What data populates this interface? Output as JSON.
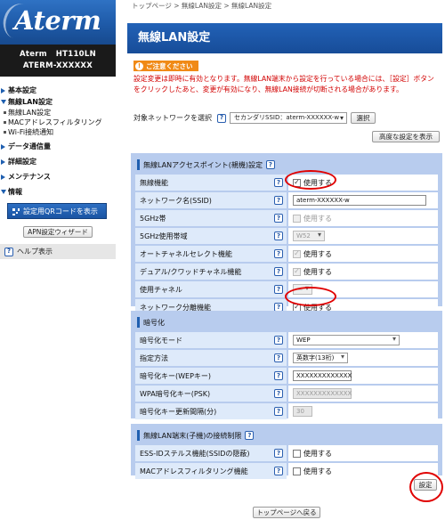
{
  "brand": {
    "logo": "Aterm",
    "model": "Aterm   HT110LN",
    "serial": "ATERM-XXXXXX"
  },
  "sidebar": {
    "items": [
      {
        "label": "基本設定",
        "expanded": false
      },
      {
        "label": "無線LAN設定",
        "expanded": true
      },
      {
        "label": "データ通信量",
        "expanded": false
      },
      {
        "label": "詳細設定",
        "expanded": false
      },
      {
        "label": "メンテナンス",
        "expanded": false
      },
      {
        "label": "情報",
        "expanded": true
      }
    ],
    "wifi_sub": [
      "無線LAN設定",
      "MACアドレスフィルタリング",
      "Wi-Fi接続通知"
    ],
    "qr_button": "設定用QRコードを表示",
    "apn_button": "APN設定ウィザード",
    "help": "ヘルプ表示"
  },
  "breadcrumb": "トップページ > 無線LAN設定 > 無線LAN設定",
  "page_title": "無線LAN設定",
  "notice": {
    "heading": "ご注意ください",
    "text": "設定変更は即時に有効となります。無線LAN端末から設定を行っている場合には、［設定］ボタンをクリックしたあと、変更が有効になり、無線LAN接続が切断される場合があります。"
  },
  "target": {
    "label": "対象ネットワークを選択",
    "value": "セカンダリSSID：aterm-XXXXXX-w",
    "button": "選択"
  },
  "advanced_button": "高度な設定を表示",
  "sections": {
    "ap": {
      "title": "無線LANアクセスポイント(親機)設定",
      "rows": {
        "enable": {
          "label": "無線機能",
          "value": "使用する",
          "checked": true
        },
        "ssid": {
          "label": "ネットワーク名(SSID)",
          "value": "aterm-XXXXXX-w"
        },
        "band5": {
          "label": "5GHz帯",
          "value": "使用する",
          "checked": false
        },
        "band5_width": {
          "label": "5GHz使用帯域",
          "value": "W52"
        },
        "auto_channel": {
          "label": "オートチャネルセレクト機能",
          "value": "使用する",
          "checked": true
        },
        "dual_channel": {
          "label": "デュアル/クワッドチャネル機能",
          "value": "使用する",
          "checked": true
        },
        "channel": {
          "label": "使用チャネル",
          "value": "—"
        },
        "separator": {
          "label": "ネットワーク分離機能",
          "value": "使用する",
          "checked": true
        }
      }
    },
    "enc": {
      "title": "暗号化",
      "rows": {
        "mode": {
          "label": "暗号化モード",
          "value": "WEP"
        },
        "method": {
          "label": "指定方法",
          "value": "英数字(13桁)"
        },
        "wep_key": {
          "label": "暗号化キー(WEPキー)",
          "value": "XXXXXXXXXXXXX"
        },
        "psk": {
          "label": "WPA暗号化キー(PSK)",
          "value": "XXXXXXXXXXXXX"
        },
        "interval": {
          "label": "暗号化キー更新間隔(分)",
          "value": "30"
        }
      }
    },
    "restrict": {
      "title": "無線LAN端末(子機)の接続制限",
      "rows": {
        "stealth": {
          "label": "ESS-IDステルス機能(SSIDの隠蔽)",
          "value": "使用する",
          "checked": false
        },
        "mac_filter": {
          "label": "MACアドレスフィルタリング機能",
          "value": "使用する",
          "checked": false
        }
      }
    }
  },
  "set_button": "設定",
  "top_button": "トップページへ戻る",
  "colors": {
    "brand_blue": "#1e5aa8",
    "panel_blue": "#b8ccee",
    "label_bg": "#deeafa",
    "notice_red": "#d20000",
    "warning_orange": "#f08a16",
    "highlight_circle": "#e00000"
  }
}
